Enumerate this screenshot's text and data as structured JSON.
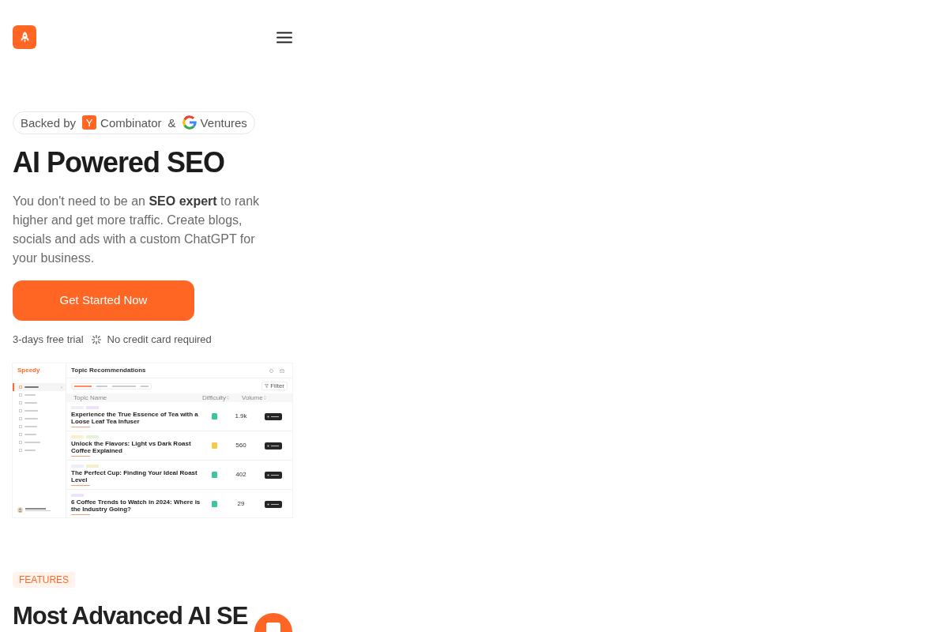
{
  "hero": {
    "badge": {
      "parts": [
        {
          "kind": "text",
          "text": "Backed by"
        },
        {
          "kind": "yc",
          "mark": "Y",
          "text": "Combinator"
        },
        {
          "kind": "text",
          "text": "&"
        },
        {
          "kind": "google",
          "text": "Ventures"
        }
      ]
    },
    "title": "AI Powered SEO",
    "description": "You don't need to be an **SEO expert** to rank higher and get more traffic. Create blogs, socials and ads with a custom ChatGPT for your business.",
    "cta": "Get Started Now",
    "perks": [
      {
        "kind": "text",
        "text": "3-days free trial"
      },
      {
        "kind": "sparkle",
        "text": "No credit card required"
      }
    ]
  },
  "preview": {
    "brand": "Speedy",
    "title": "Topic Recommendations",
    "nav": [
      {
        "selected": true
      },
      {
        "selected": false
      },
      {
        "selected": false
      },
      {
        "selected": false
      },
      {
        "selected": false
      },
      {
        "selected": false
      },
      {
        "selected": false
      },
      {
        "selected": false
      },
      {
        "selected": false
      }
    ],
    "tabs": [
      {
        "selected": true
      },
      {
        "selected": false
      },
      {
        "selected": false
      },
      {
        "selected": false
      }
    ],
    "filter": "Filter",
    "columns": [
      {
        "label": "Topic Name",
        "sortable": false
      },
      {
        "label": "Difficulty",
        "sortable": true
      },
      {
        "label": "Volume",
        "sortable": true
      }
    ],
    "rows": [
      {
        "tags": [
          {
            "color": "#eceff5"
          },
          {
            "color": "#ede1fb"
          }
        ],
        "title": "Experience the True Essence of Tea with a Loose Leaf Tea Infuser",
        "difficulty": {
          "color": "#3ec4a2"
        },
        "volume": "1.9k"
      },
      {
        "tags": [
          {
            "color": "#fbefc7"
          },
          {
            "color": "#e6f2d6"
          }
        ],
        "title": "Unlock the Flavors: Light vs Dark Roast Coffee Explained",
        "difficulty": {
          "color": "#f6c94a"
        },
        "volume": "560"
      },
      {
        "tags": [
          {
            "color": "#eceff5"
          },
          {
            "color": "#f1f0cc"
          }
        ],
        "title": "The Perfect Cup: Finding Your Ideal Roast Level",
        "difficulty": {
          "color": "#3ec4a2"
        },
        "volume": "402"
      },
      {
        "tags": [
          {
            "color": "#ede1fb"
          }
        ],
        "title": "6 Coffee Trends to Watch in 2024: Where is the Industry Going?",
        "difficulty": {
          "color": "#3ec4a2"
        },
        "volume": "29"
      }
    ]
  },
  "features": {
    "label": "FEATURES",
    "title": "Most Advanced AI SE"
  }
}
